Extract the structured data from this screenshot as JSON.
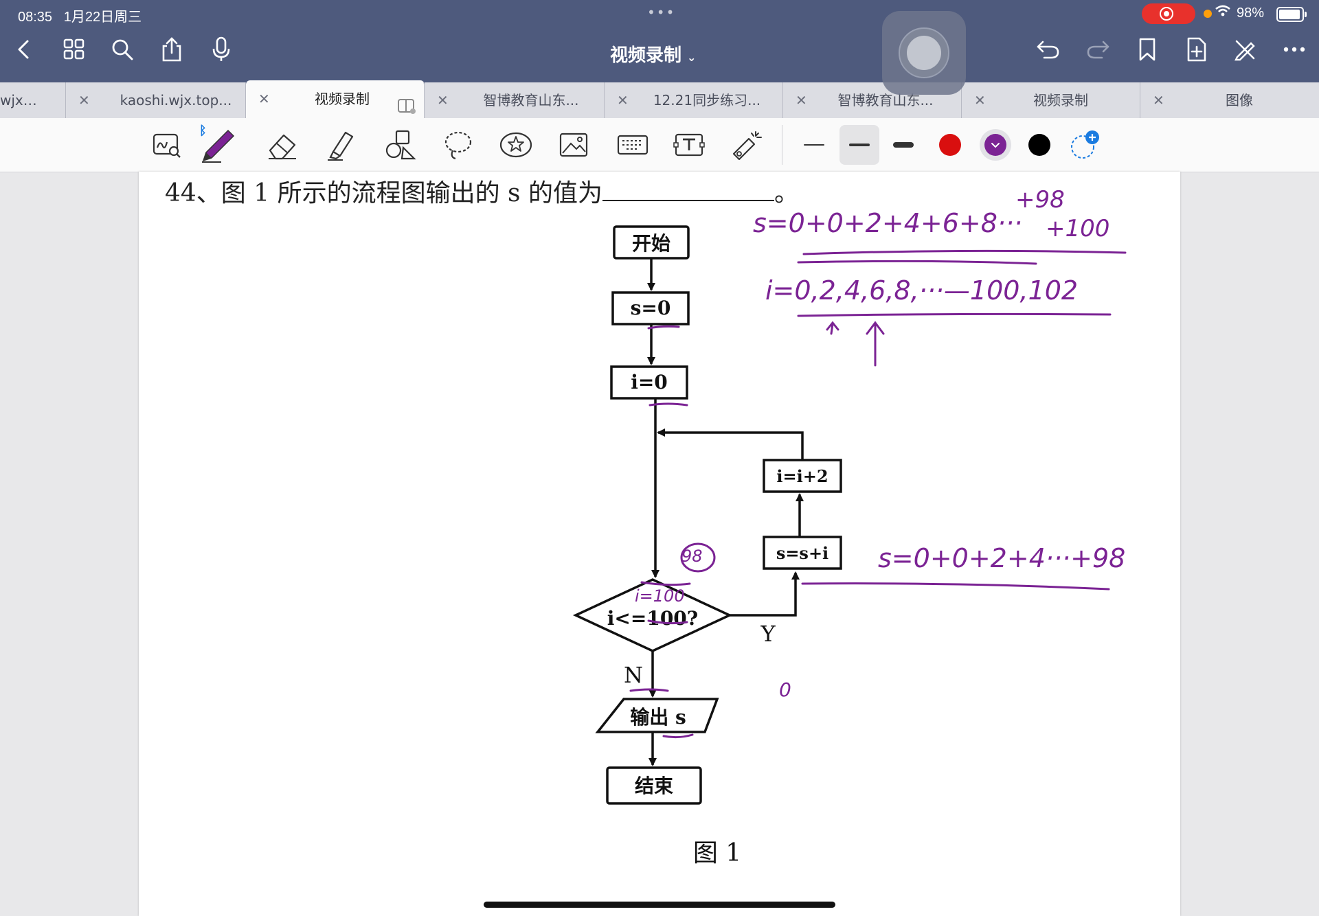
{
  "status": {
    "time": "08:35",
    "date": "1月22日周三",
    "battery": "98%"
  },
  "header": {
    "title": "视频录制"
  },
  "tabs": [
    {
      "label": "wjx.top"
    },
    {
      "label": "kaoshi.wjx.top..."
    },
    {
      "label": "视频录制",
      "active": true
    },
    {
      "label": "智博教育山东..."
    },
    {
      "label": "12.21同步练习..."
    },
    {
      "label": "智博教育山东..."
    },
    {
      "label": "视频录制"
    },
    {
      "label": "图像"
    }
  ],
  "toolbar": {
    "tools": [
      "zoom-write-icon",
      "pen-icon",
      "eraser-icon",
      "highlighter-icon",
      "shapes-icon",
      "lasso-icon",
      "sticker-icon",
      "image-icon",
      "keyboard-icon",
      "text-box-icon",
      "laser-pointer-icon"
    ],
    "stroke_widths": [
      "thin",
      "medium",
      "thick"
    ],
    "colors": [
      "#d90f0f",
      "#7b2394",
      "#000000"
    ],
    "selected_color": "#7b2394"
  },
  "document": {
    "question": "44、图 1 所示的流程图输出的 s 的值为",
    "question_end": "。",
    "figure_caption": "图  1",
    "flowchart": {
      "start": "开始",
      "init_s": "s=0",
      "init_i": "i=0",
      "condition": "i<=100?",
      "yes_label": "Y",
      "no_label": "N",
      "step_s": "s=s+i",
      "step_i": "i=i+2",
      "output": "输出 s",
      "end": "结束"
    },
    "handwriting": {
      "sum_line": "s=0+0+2+4+6+8···",
      "sum_above": "+98",
      "sum_tail": "+100",
      "i_sequence": "i=0,2,4,6,8,···—100,102",
      "condition_note": "i=100",
      "circled": "98",
      "loop_note": "s=0+0+2+4···+98",
      "stray_zero": "0"
    }
  }
}
